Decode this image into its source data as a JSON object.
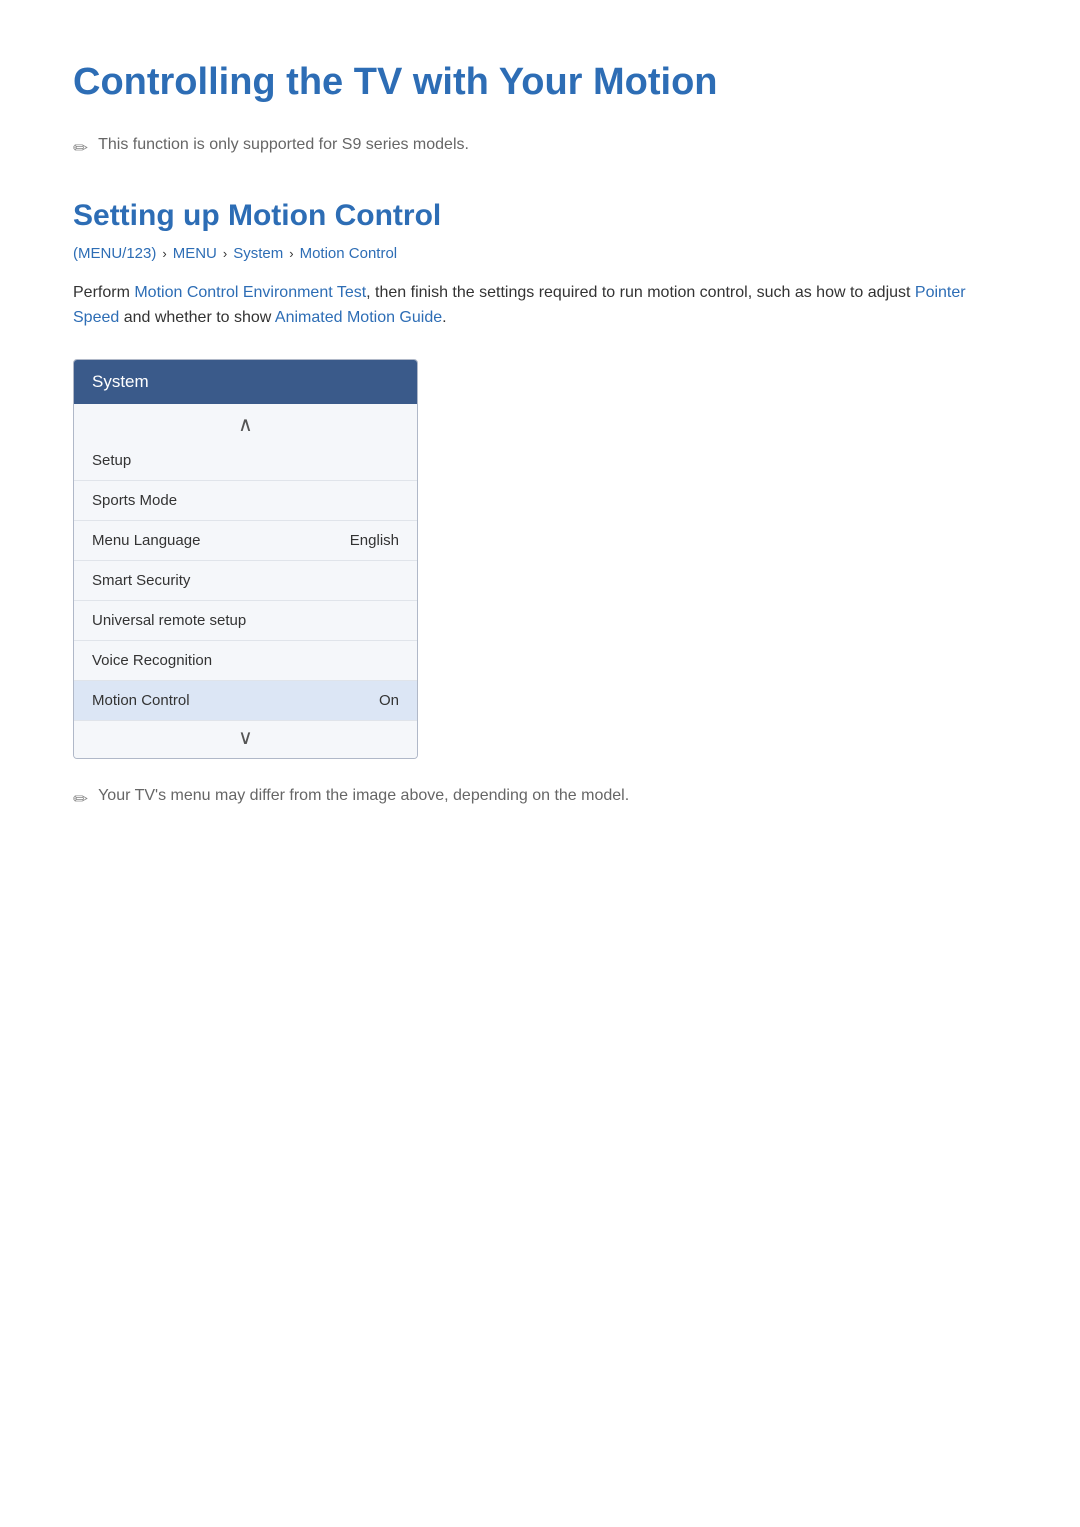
{
  "page": {
    "title": "Controlling the TV with Your Motion",
    "note1": "This function is only supported for S9 series models.",
    "note2": "Your TV's menu may differ from the image above, depending on the model."
  },
  "section": {
    "title": "Setting up Motion Control",
    "breadcrumb": {
      "items": [
        {
          "label": "(MENU/123)",
          "separator": true
        },
        {
          "label": "MENU",
          "separator": true
        },
        {
          "label": "System",
          "separator": true
        },
        {
          "label": "Motion Control",
          "separator": false
        }
      ]
    },
    "body_prefix": "Perform ",
    "link1": "Motion Control Environment Test",
    "body_middle": ", then finish the settings required to run motion control, such as how to adjust ",
    "link2": "Pointer Speed",
    "body_middle2": " and whether to show ",
    "link3": "Animated Motion Guide",
    "body_suffix": "."
  },
  "menu": {
    "header": "System",
    "chevron_up": "∧",
    "chevron_down": "∨",
    "items": [
      {
        "label": "Setup",
        "value": "",
        "highlighted": false
      },
      {
        "label": "Sports Mode",
        "value": "",
        "highlighted": false
      },
      {
        "label": "Menu Language",
        "value": "English",
        "highlighted": false
      },
      {
        "label": "Smart Security",
        "value": "",
        "highlighted": false
      },
      {
        "label": "Universal remote setup",
        "value": "",
        "highlighted": false
      },
      {
        "label": "Voice Recognition",
        "value": "",
        "highlighted": false
      },
      {
        "label": "Motion Control",
        "value": "On",
        "highlighted": true
      }
    ]
  },
  "icons": {
    "pencil": "✏"
  }
}
